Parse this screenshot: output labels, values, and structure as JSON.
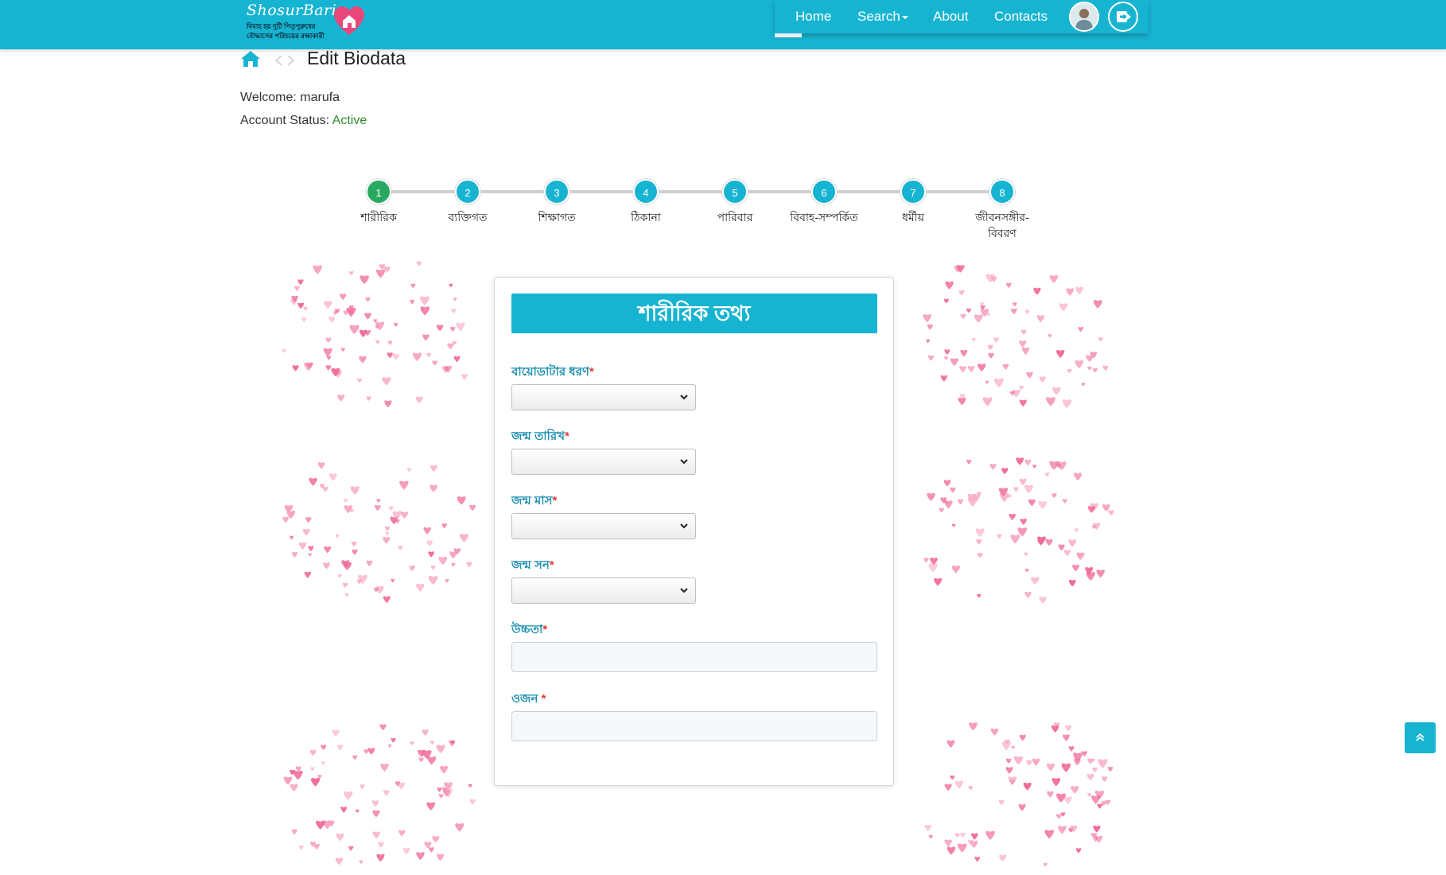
{
  "header": {
    "brand": "ShosurBari",
    "tagline_1": "বিবাহ হয় দুটি পিতৃপুরুষের",
    "tagline_2": "বৌদ্ধাসের পরিচয়ের রক্ষাকারী",
    "nav": {
      "home": "Home",
      "search": "Search",
      "about": "About",
      "contacts": "Contacts"
    },
    "accent_color": "#17b4d2"
  },
  "breadcrumb": {
    "title": "Edit Biodata"
  },
  "account": {
    "welcome_label": "Welcome",
    "username": "marufa",
    "status_label": "Account Status",
    "status_value": "Active"
  },
  "steps": [
    {
      "number": "1",
      "label": "শারীরিক",
      "state": "done"
    },
    {
      "number": "2",
      "label": "ব্যক্তিগত",
      "state": "todo"
    },
    {
      "number": "3",
      "label": "শিক্ষাগত",
      "state": "todo"
    },
    {
      "number": "4",
      "label": "ঠিকানা",
      "state": "todo"
    },
    {
      "number": "5",
      "label": "পারিবার",
      "state": "todo"
    },
    {
      "number": "6",
      "label": "বিবাহ-সম্পর্কিত",
      "state": "todo"
    },
    {
      "number": "7",
      "label": "ধর্মীয়",
      "state": "todo"
    },
    {
      "number": "8",
      "label": "জীবনসঙ্গীর-বিবরণ",
      "state": "todo"
    }
  ],
  "form": {
    "title": "শারীরিক তথ্য",
    "fields": {
      "biodata_type": "বায়োডাটার ধরণ",
      "birth_day": "জন্ম তারিখ",
      "birth_month": "জন্ম মাস",
      "birth_year": "জন্ম সন",
      "height": "উচ্চতা",
      "weight": "ওজন"
    },
    "required_mark": "*"
  }
}
